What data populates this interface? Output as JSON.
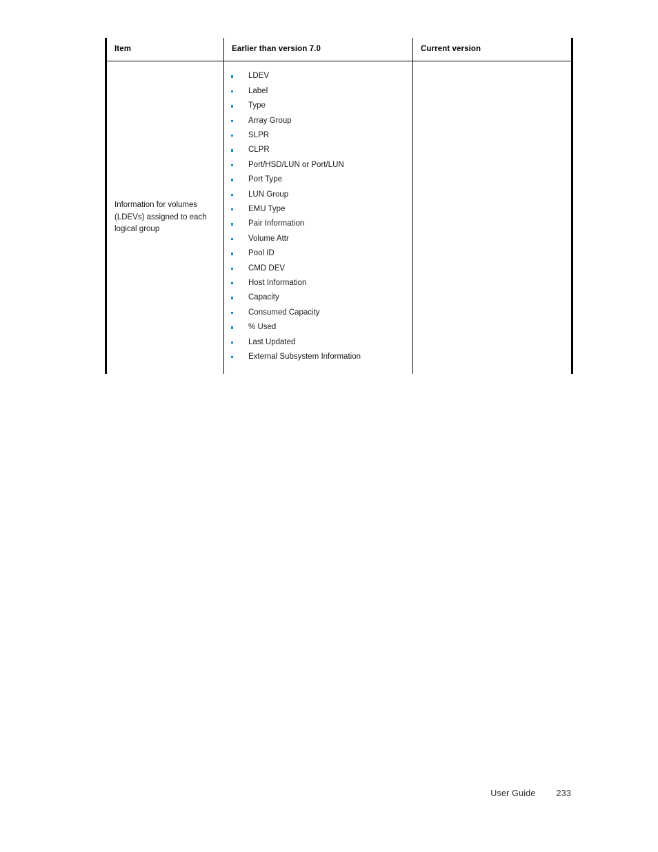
{
  "colors": {
    "bullet": "#0e92c4",
    "rule": "#000000",
    "text": "#1a1a1a"
  },
  "table": {
    "headers": [
      "Item",
      "Earlier than version 7.0",
      "Current version"
    ],
    "rows": [
      {
        "item": "Information for volumes (LDEVs) assigned to each logical group",
        "earlier_than_v7": [
          "LDEV",
          "Label",
          "Type",
          "Array Group",
          "SLPR",
          "CLPR",
          "Port/HSD/LUN or Port/LUN",
          "Port Type",
          "LUN Group",
          "EMU Type",
          "Pair Information",
          "Volume Attr",
          "Pool ID",
          "CMD DEV",
          "Host Information",
          "Capacity",
          "Consumed Capacity",
          "% Used",
          "Last Updated",
          "External Subsystem Information"
        ],
        "current_version": ""
      }
    ]
  },
  "footer": {
    "guide_label": "User Guide",
    "page_number": "233"
  }
}
